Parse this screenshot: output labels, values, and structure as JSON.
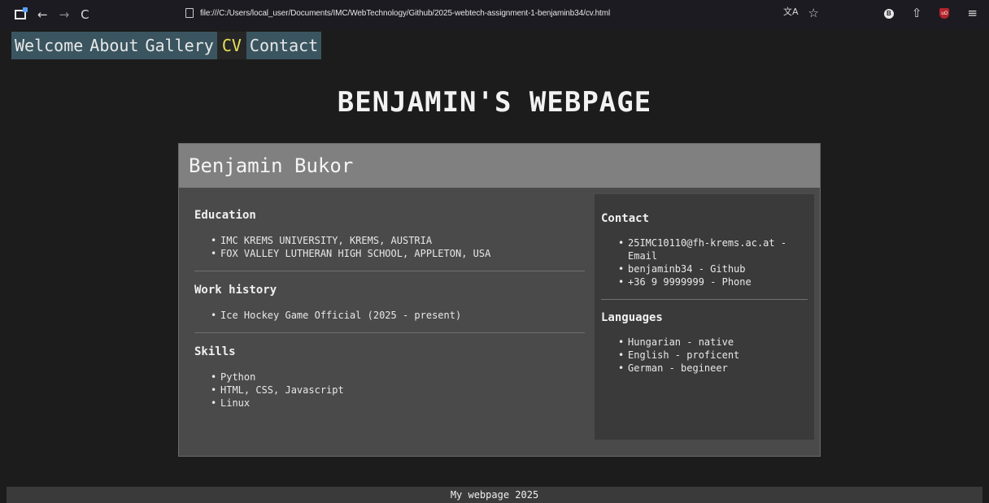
{
  "browser": {
    "url": "file:///C:/Users/local_user/Documents/IMC/WebTechnology/Github/2025-webtech-assignment-1-benjaminb34/cv.html",
    "back_icon": "←",
    "forward_icon": "→",
    "reload_icon": "C",
    "translate_icon": "文A",
    "star_icon": "☆",
    "extensions_icon": "⇧",
    "menu_icon": "≡",
    "ext1_label": "B",
    "ublock_label": "uO"
  },
  "nav": {
    "items": [
      {
        "label": "Welcome"
      },
      {
        "label": "About"
      },
      {
        "label": "Gallery"
      },
      {
        "label": "CV"
      },
      {
        "label": "Contact"
      }
    ],
    "active": "CV"
  },
  "page": {
    "title": "BENJAMIN'S WEBPAGE",
    "footer": "My webpage 2025"
  },
  "cv": {
    "name": "Benjamin Bukor",
    "education": {
      "title": "Education",
      "items": [
        "IMC KREMS UNIVERSITY, KREMS, AUSTRIA",
        "FOX VALLEY LUTHERAN HIGH SCHOOL, APPLETON, USA"
      ]
    },
    "work": {
      "title": "Work history",
      "items": [
        "Ice Hockey Game Official (2025 - present)"
      ]
    },
    "skills": {
      "title": "Skills",
      "items": [
        "Python",
        "HTML, CSS, Javascript",
        "Linux"
      ]
    },
    "contact": {
      "title": "Contact",
      "items": [
        "25IMC10110@fh-krems.ac.at - Email",
        "benjaminb34 - Github",
        "+36 9 9999999 - Phone"
      ]
    },
    "languages": {
      "title": "Languages",
      "items": [
        "Hungarian - native",
        "English - proficent",
        "German - begineer"
      ]
    }
  },
  "colors": {
    "background": "#1c1c1c",
    "nav_bg": "#3a5560",
    "nav_active_text": "#e8e05a",
    "card_header": "#808080",
    "card_body": "#4a4a4a",
    "sidebar": "#3a3a3a"
  }
}
